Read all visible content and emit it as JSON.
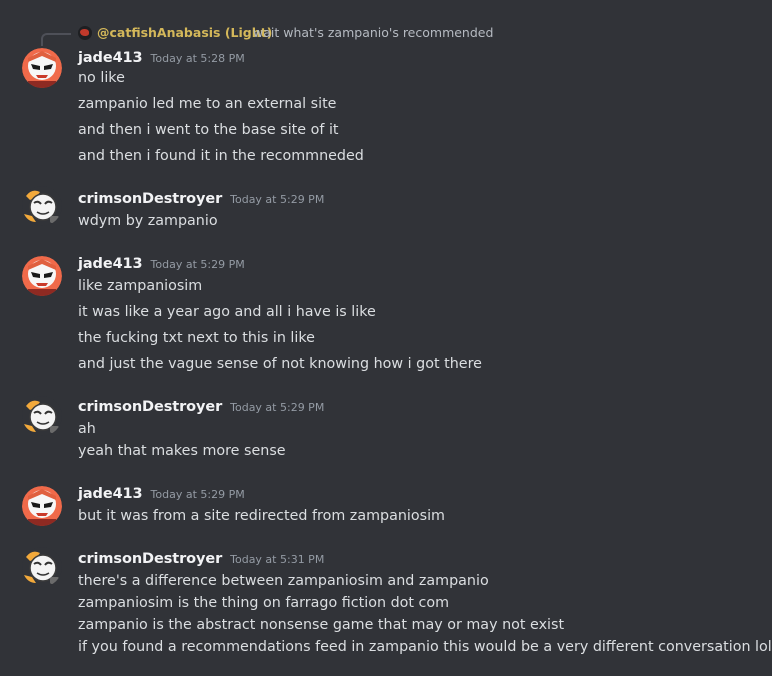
{
  "reply": {
    "username": "@catfishAnabasis (Light)",
    "text": "wait what's zampanio's recommended"
  },
  "colors": {
    "background": "#313338",
    "reply_name": "#d4b85a",
    "username": "#f2f3f5",
    "timestamp": "#949ba4",
    "text": "#dbdee1"
  },
  "messages": [
    {
      "username": "jade413",
      "avatar": "jade-avatar",
      "timestamp": "Today at 5:28 PM",
      "lines": [
        "no like",
        "zampanio led me to an external site",
        "and then i went to the base site of it",
        "and then i found it in the recommneded"
      ]
    },
    {
      "username": "crimsonDestroyer",
      "avatar": "crimson-avatar",
      "timestamp": "Today at 5:29 PM",
      "lines": [
        "wdym by zampanio"
      ]
    },
    {
      "username": "jade413",
      "avatar": "jade-avatar",
      "timestamp": "Today at 5:29 PM",
      "lines": [
        "like zampaniosim",
        "it was like a year ago and all i have is like",
        "the fucking txt next to this in like",
        "and just the vague sense of not knowing how i got there"
      ]
    },
    {
      "username": "crimsonDestroyer",
      "avatar": "crimson-avatar",
      "timestamp": "Today at 5:29 PM",
      "lines": [
        "ah",
        "yeah that makes more sense"
      ]
    },
    {
      "username": "jade413",
      "avatar": "jade-avatar",
      "timestamp": "Today at 5:29 PM",
      "lines": [
        "but it was from a site redirected from zampaniosim"
      ]
    },
    {
      "username": "crimsonDestroyer",
      "avatar": "crimson-avatar",
      "timestamp": "Today at 5:31 PM",
      "lines": [
        "there's a difference between zampaniosim and zampanio",
        "zampaniosim is the thing on farrago fiction dot com",
        "zampanio is the abstract nonsense game that may or may not exist",
        "if you found a recommendations feed in zampanio this would be a very different conversation lol"
      ]
    }
  ]
}
